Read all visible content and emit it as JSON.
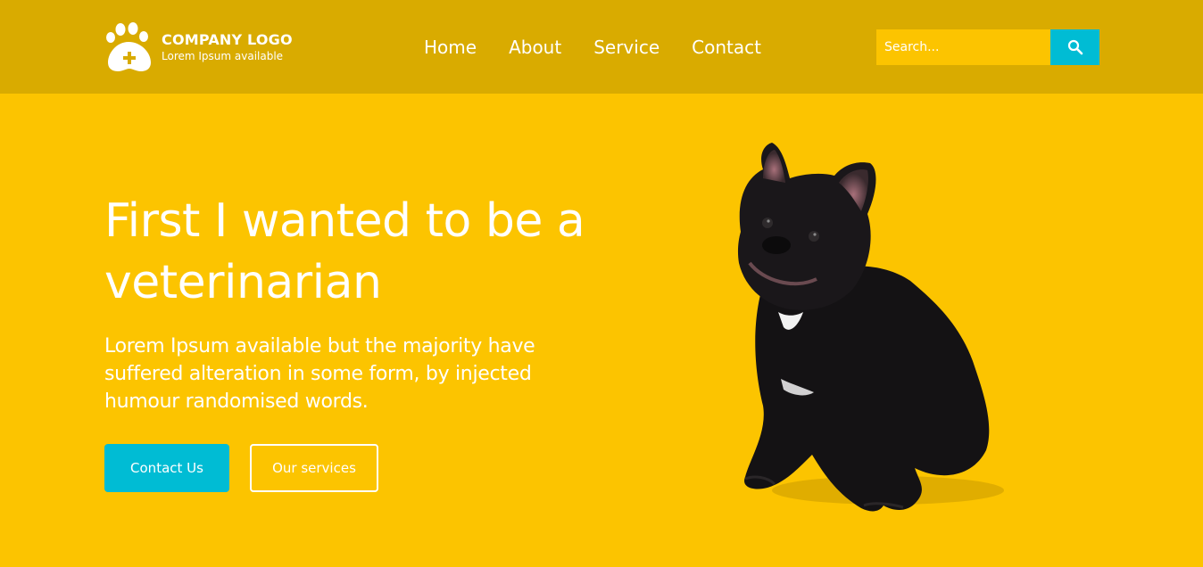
{
  "brand": {
    "title": "COMPANY LOGO",
    "subtitle": "Lorem Ipsum available",
    "icon": "paw-plus-icon"
  },
  "nav": {
    "items": [
      {
        "label": "Home"
      },
      {
        "label": "About"
      },
      {
        "label": "Service"
      },
      {
        "label": "Contact"
      }
    ]
  },
  "search": {
    "placeholder": "Search...",
    "value": "",
    "button_icon": "search-icon"
  },
  "hero": {
    "title": "First I wanted to be a veterinarian",
    "text": "Lorem Ipsum available but the majority have suffered alteration in some form, by injected humour randomised words.",
    "primary_button": "Contact Us",
    "secondary_button": "Our services",
    "image": "french-bulldog-photo"
  },
  "colors": {
    "header_bg": "#d9ab00",
    "page_bg": "#fcc400",
    "accent": "#00bcd4",
    "text": "#ffffff"
  }
}
